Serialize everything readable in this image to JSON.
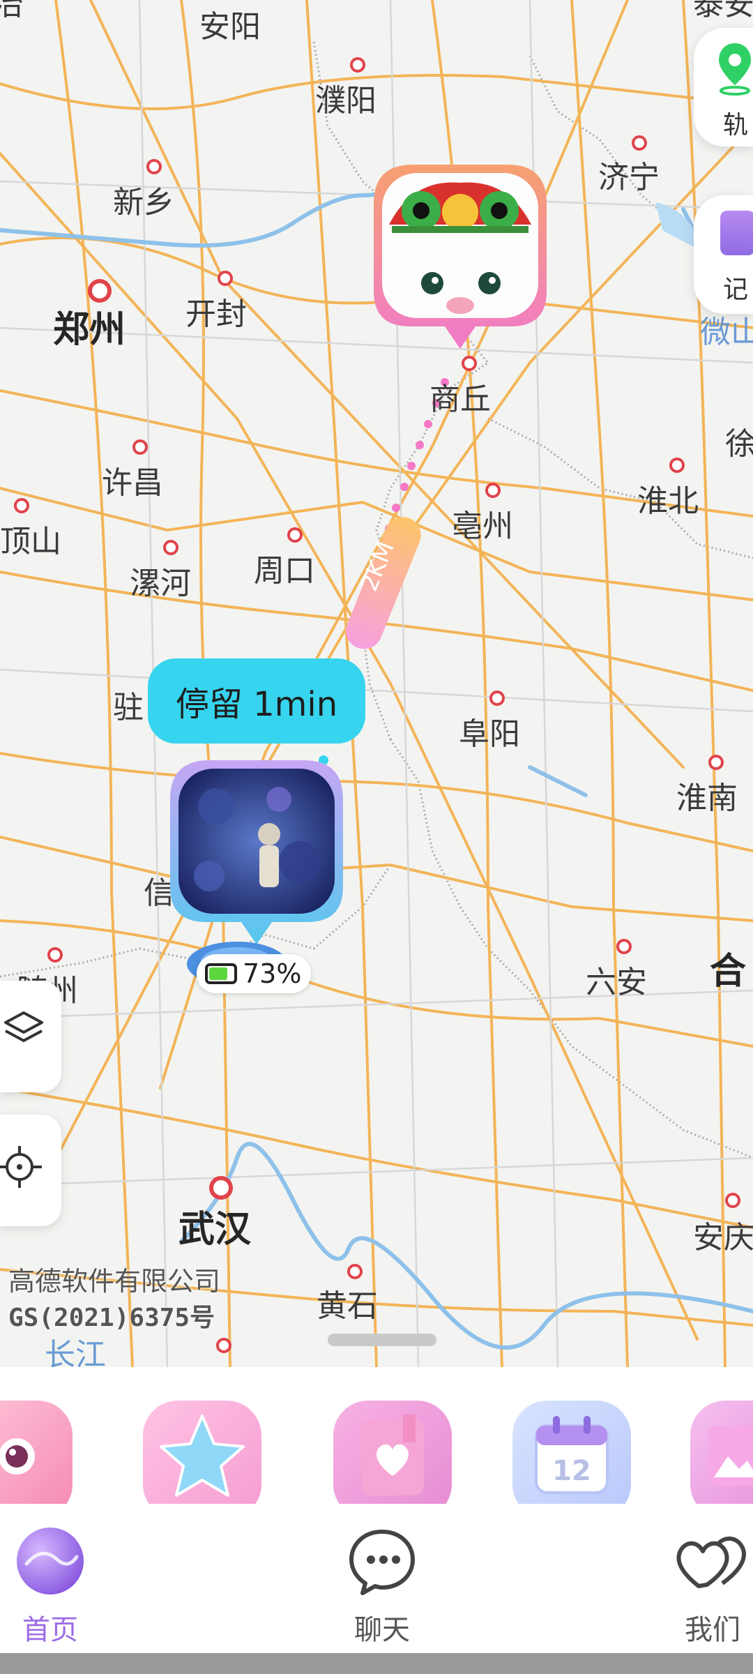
{
  "map": {
    "cities": [
      {
        "id": "anyang",
        "name": "安阳"
      },
      {
        "id": "puyang",
        "name": "濮阳"
      },
      {
        "id": "xinxiang",
        "name": "新乡"
      },
      {
        "id": "jining",
        "name": "济宁"
      },
      {
        "id": "zhengzhou",
        "name": "郑州"
      },
      {
        "id": "kaifeng",
        "name": "开封"
      },
      {
        "id": "weishan",
        "name": "微山"
      },
      {
        "id": "shangqiu",
        "name": "商丘"
      },
      {
        "id": "xu",
        "name": "徐"
      },
      {
        "id": "xuchang",
        "name": "许昌"
      },
      {
        "id": "huaibei",
        "name": "淮北"
      },
      {
        "id": "dingshan",
        "name": "顶山"
      },
      {
        "id": "bozhou",
        "name": "亳州"
      },
      {
        "id": "luohe",
        "name": "漯河"
      },
      {
        "id": "zhoukou",
        "name": "周口"
      },
      {
        "id": "zhu",
        "name": "驻"
      },
      {
        "id": "fuyang",
        "name": "阜阳"
      },
      {
        "id": "huainan",
        "name": "淮南"
      },
      {
        "id": "xin",
        "name": "信"
      },
      {
        "id": "suizhou",
        "name": "随州"
      },
      {
        "id": "luan",
        "name": "六安"
      },
      {
        "id": "he",
        "name": "合"
      },
      {
        "id": "wuhan",
        "name": "武汉"
      },
      {
        "id": "anqing",
        "name": "安庆"
      },
      {
        "id": "huangshi",
        "name": "黄石"
      },
      {
        "id": "changjiang",
        "name": "长江"
      },
      {
        "id": "topcut",
        "name": "泰安"
      },
      {
        "id": "leftcut",
        "name": "冶"
      }
    ],
    "attribution": "高德软件有限公司",
    "license": "GS(2021)6375号",
    "distance_label": "2KM",
    "stay_label": "停留 1min",
    "battery_percent": "73%"
  },
  "side_buttons": {
    "track": "轨",
    "record": "记"
  },
  "features": [
    {
      "icon": "camera-icon",
      "color": "#f7a3c4"
    },
    {
      "icon": "star-icon",
      "color": "#7fd0f5"
    },
    {
      "icon": "diary-icon",
      "color": "#f3a8d8"
    },
    {
      "icon": "calendar-icon",
      "color": "#a9c4f7",
      "text": "12"
    },
    {
      "icon": "album-icon",
      "color": "#f0a7e0"
    }
  ],
  "tabs": [
    {
      "id": "home",
      "label": "首页",
      "icon": "planet-icon",
      "active": true
    },
    {
      "id": "chat",
      "label": "聊天",
      "icon": "chat-bubble-icon",
      "active": false
    },
    {
      "id": "us",
      "label": "我们",
      "icon": "hearts-icon",
      "active": false
    }
  ],
  "colors": {
    "accent": "#9b6be6",
    "stay_bubble": "#36d4ee",
    "road": "#f3b458",
    "water": "#8ec1ea",
    "route_dot": "#f578c7"
  }
}
